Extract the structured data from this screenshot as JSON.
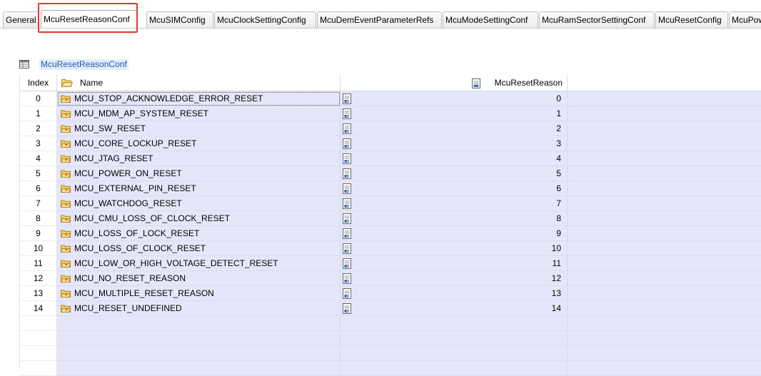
{
  "tabs": [
    {
      "label": "General"
    },
    {
      "label": "McuResetReasonConf"
    },
    {
      "label": "McuSIMConfig"
    },
    {
      "label": "McuClockSettingConfig"
    },
    {
      "label": "McuDemEventParameterRefs"
    },
    {
      "label": "McuModeSettingConf"
    },
    {
      "label": "McuRamSectorSettingConf"
    },
    {
      "label": "McuResetConfig"
    },
    {
      "label": "McuPow"
    }
  ],
  "active_tab_index": 1,
  "section": {
    "title": "McuResetReasonConf",
    "icon": "table-icon"
  },
  "table": {
    "headers": {
      "index": "Index",
      "name": "Name",
      "value": "McuResetReason"
    },
    "rows": [
      {
        "index": "0",
        "name": "MCU_STOP_ACKNOWLEDGE_ERROR_RESET",
        "value": "0"
      },
      {
        "index": "1",
        "name": "MCU_MDM_AP_SYSTEM_RESET",
        "value": "1"
      },
      {
        "index": "2",
        "name": "MCU_SW_RESET",
        "value": "2"
      },
      {
        "index": "3",
        "name": "MCU_CORE_LOCKUP_RESET",
        "value": "3"
      },
      {
        "index": "4",
        "name": "MCU_JTAG_RESET",
        "value": "4"
      },
      {
        "index": "5",
        "name": "MCU_POWER_ON_RESET",
        "value": "5"
      },
      {
        "index": "6",
        "name": "MCU_EXTERNAL_PIN_RESET",
        "value": "6"
      },
      {
        "index": "7",
        "name": "MCU_WATCHDOG_RESET",
        "value": "7"
      },
      {
        "index": "8",
        "name": "MCU_CMU_LOSS_OF_CLOCK_RESET",
        "value": "8"
      },
      {
        "index": "9",
        "name": "MCU_LOSS_OF_LOCK_RESET",
        "value": "9"
      },
      {
        "index": "10",
        "name": "MCU_LOSS_OF_CLOCK_RESET",
        "value": "10"
      },
      {
        "index": "11",
        "name": "MCU_LOW_OR_HIGH_VOLTAGE_DETECT_RESET",
        "value": "11"
      },
      {
        "index": "12",
        "name": "MCU_NO_RESET_REASON",
        "value": "12"
      },
      {
        "index": "13",
        "name": "MCU_MULTIPLE_RESET_REASON",
        "value": "13"
      },
      {
        "index": "14",
        "name": "MCU_RESET_UNDEFINED",
        "value": "14"
      }
    ],
    "empty_rows": 4
  },
  "colors": {
    "row_bg": "#e6e6fa",
    "highlight": "#e23a2e",
    "link": "#1a5fb4"
  }
}
